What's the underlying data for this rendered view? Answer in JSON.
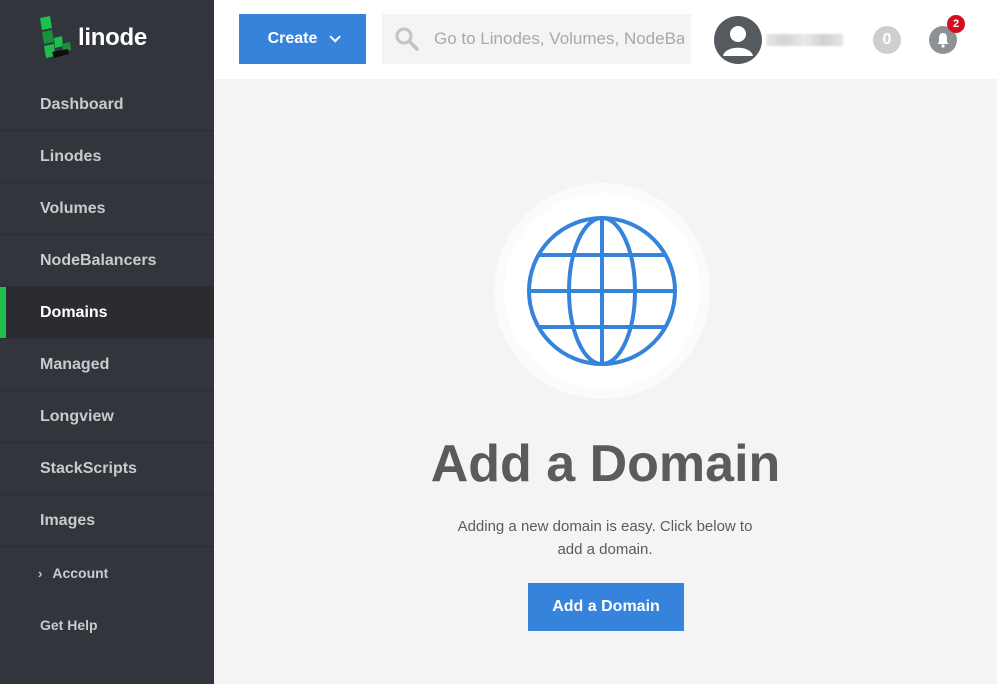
{
  "brand": {
    "name": "linode",
    "accent": "#1fbf4d"
  },
  "sidebar": {
    "items": [
      {
        "label": "Dashboard"
      },
      {
        "label": "Linodes"
      },
      {
        "label": "Volumes"
      },
      {
        "label": "NodeBalancers"
      },
      {
        "label": "Domains",
        "active": true
      },
      {
        "label": "Managed"
      },
      {
        "label": "Longview"
      },
      {
        "label": "StackScripts"
      },
      {
        "label": "Images"
      }
    ],
    "account_label": "Account",
    "help_label": "Get Help"
  },
  "header": {
    "create_label": "Create",
    "search_placeholder": "Go to Linodes, Volumes, NodeBalancers, Domains...",
    "events_count": "0",
    "notifications_count": "2"
  },
  "main": {
    "heading": "Add a Domain",
    "description": "Adding a new domain is easy. Click below to add a domain.",
    "button_label": "Add a Domain",
    "icon": "globe-icon"
  },
  "colors": {
    "primary": "#3683dc",
    "sidebar": "#32363c",
    "alert": "#d00f1f"
  }
}
